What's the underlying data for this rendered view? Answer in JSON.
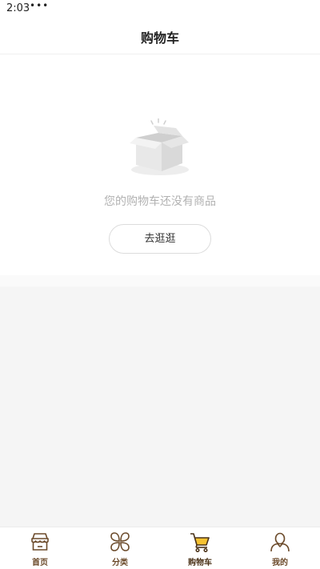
{
  "status_bar": {
    "time": "2:03",
    "dots": "•••"
  },
  "header": {
    "title": "购物车"
  },
  "empty_state": {
    "message": "您的购物车还没有商品",
    "button_label": "去逛逛",
    "icon": "empty-box-icon"
  },
  "tab_bar": {
    "items": [
      {
        "label": "首页",
        "icon": "storefront-icon",
        "active": false
      },
      {
        "label": "分类",
        "icon": "clover-icon",
        "active": false
      },
      {
        "label": "购物车",
        "icon": "cart-icon",
        "active": true
      },
      {
        "label": "我的",
        "icon": "user-icon",
        "active": false
      }
    ]
  },
  "colors": {
    "icon_stroke": "#6b4a2a",
    "active_accent": "#f6c231",
    "page_background": "#f5f5f5"
  }
}
